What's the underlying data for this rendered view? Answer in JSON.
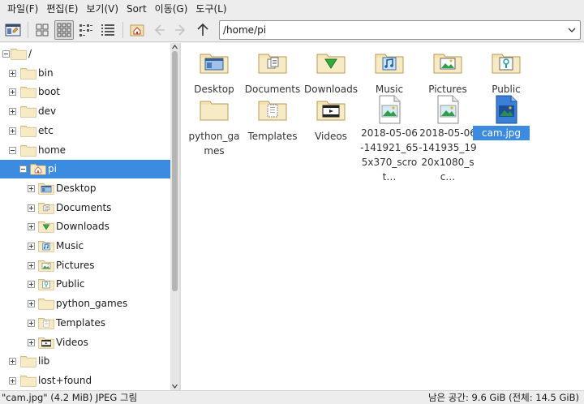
{
  "menubar": {
    "items": [
      "파일(F)",
      "편집(E)",
      "보기(V)",
      "Sort",
      "이동(G)",
      "도구(L)"
    ]
  },
  "toolbar": {
    "path_value": "/home/pi"
  },
  "tree": {
    "rows": [
      {
        "label": "/",
        "depth": 0,
        "expander": "minus",
        "icon": "folder"
      },
      {
        "label": "bin",
        "depth": 1,
        "expander": "plus",
        "icon": "folder"
      },
      {
        "label": "boot",
        "depth": 1,
        "expander": "plus",
        "icon": "folder"
      },
      {
        "label": "dev",
        "depth": 1,
        "expander": "plus",
        "icon": "folder"
      },
      {
        "label": "etc",
        "depth": 1,
        "expander": "plus",
        "icon": "folder"
      },
      {
        "label": "home",
        "depth": 1,
        "expander": "minus",
        "icon": "folder"
      },
      {
        "label": "pi",
        "depth": 2,
        "expander": "minus",
        "icon": "home-folder",
        "selected": true
      },
      {
        "label": "Desktop",
        "depth": 3,
        "expander": "plus",
        "icon": "desktop-folder"
      },
      {
        "label": "Documents",
        "depth": 3,
        "expander": "plus",
        "icon": "documents-folder"
      },
      {
        "label": "Downloads",
        "depth": 3,
        "expander": "plus",
        "icon": "downloads-folder"
      },
      {
        "label": "Music",
        "depth": 3,
        "expander": "plus",
        "icon": "music-folder"
      },
      {
        "label": "Pictures",
        "depth": 3,
        "expander": "plus",
        "icon": "pictures-folder"
      },
      {
        "label": "Public",
        "depth": 3,
        "expander": "plus",
        "icon": "public-folder"
      },
      {
        "label": "python_games",
        "depth": 3,
        "expander": "plus",
        "icon": "folder"
      },
      {
        "label": "Templates",
        "depth": 3,
        "expander": "plus",
        "icon": "templates-folder"
      },
      {
        "label": "Videos",
        "depth": 3,
        "expander": "plus",
        "icon": "videos-folder"
      },
      {
        "label": "lib",
        "depth": 1,
        "expander": "plus",
        "icon": "folder"
      },
      {
        "label": "lost+found",
        "depth": 1,
        "expander": "plus",
        "icon": "folder"
      }
    ]
  },
  "files": [
    {
      "name": "Desktop",
      "icon": "desktop-folder"
    },
    {
      "name": "Documents",
      "icon": "documents-folder"
    },
    {
      "name": "Downloads",
      "icon": "downloads-folder"
    },
    {
      "name": "Music",
      "icon": "music-folder"
    },
    {
      "name": "Pictures",
      "icon": "pictures-folder"
    },
    {
      "name": "Public",
      "icon": "public-folder"
    },
    {
      "name": "python_games",
      "icon": "folder"
    },
    {
      "name": "Templates",
      "icon": "templates-folder"
    },
    {
      "name": "Videos",
      "icon": "videos-folder"
    },
    {
      "name": "2018-05-06-141921_655x370_scrot…",
      "icon": "image-file"
    },
    {
      "name": "2018-05-06-141935_1920x1080_sc…",
      "icon": "image-file"
    },
    {
      "name": "cam.jpg",
      "icon": "image-file-selected",
      "selected": true
    }
  ],
  "statusbar": {
    "left": "\"cam.jpg\" (4.2 MiB) JPEG 그림",
    "right": "남은 공간: 9.6 GiB (전체: 14.5 GiB)"
  },
  "colors": {
    "selection": "#3b8be0",
    "folder_fill": "#f3e2b3",
    "folder_stroke": "#b99a55"
  }
}
